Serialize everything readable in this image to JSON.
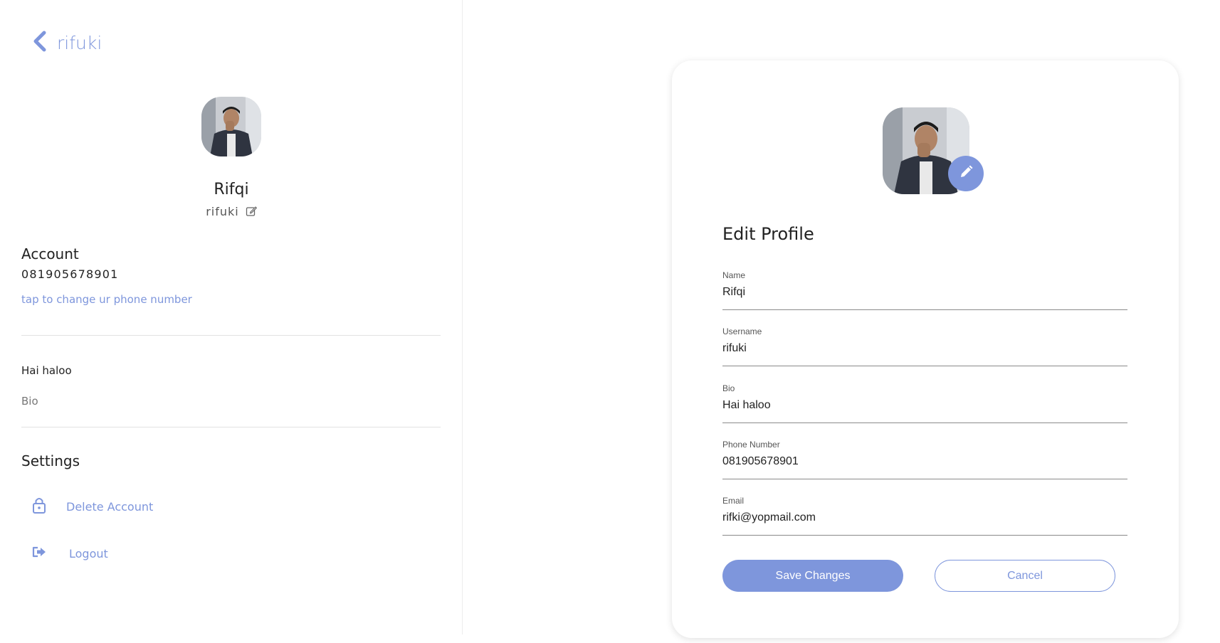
{
  "colors": {
    "accent": "#7e96dc",
    "text": "#222222",
    "muted": "#777777",
    "divider": "#e2e2e2"
  },
  "sidebar": {
    "back_label": "rifuki",
    "display_name": "Rifqi",
    "username": "rifuki",
    "account": {
      "title": "Account",
      "phone": "081905678901",
      "change_phone_link": "tap to change ur phone number"
    },
    "bio": {
      "value": "Hai haloo",
      "label": "Bio"
    },
    "settings": {
      "title": "Settings",
      "items": [
        {
          "label": "Delete Account",
          "icon": "lock-icon"
        },
        {
          "label": "Logout",
          "icon": "logout-icon"
        }
      ]
    }
  },
  "edit_profile": {
    "title": "Edit Profile",
    "fields": [
      {
        "label": "Name",
        "value": "Rifqi"
      },
      {
        "label": "Username",
        "value": "rifuki"
      },
      {
        "label": "Bio",
        "value": "Hai haloo"
      },
      {
        "label": "Phone Number",
        "value": "081905678901"
      },
      {
        "label": "Email",
        "value": "rifki@yopmail.com"
      }
    ],
    "save_label": "Save Changes",
    "cancel_label": "Cancel"
  }
}
